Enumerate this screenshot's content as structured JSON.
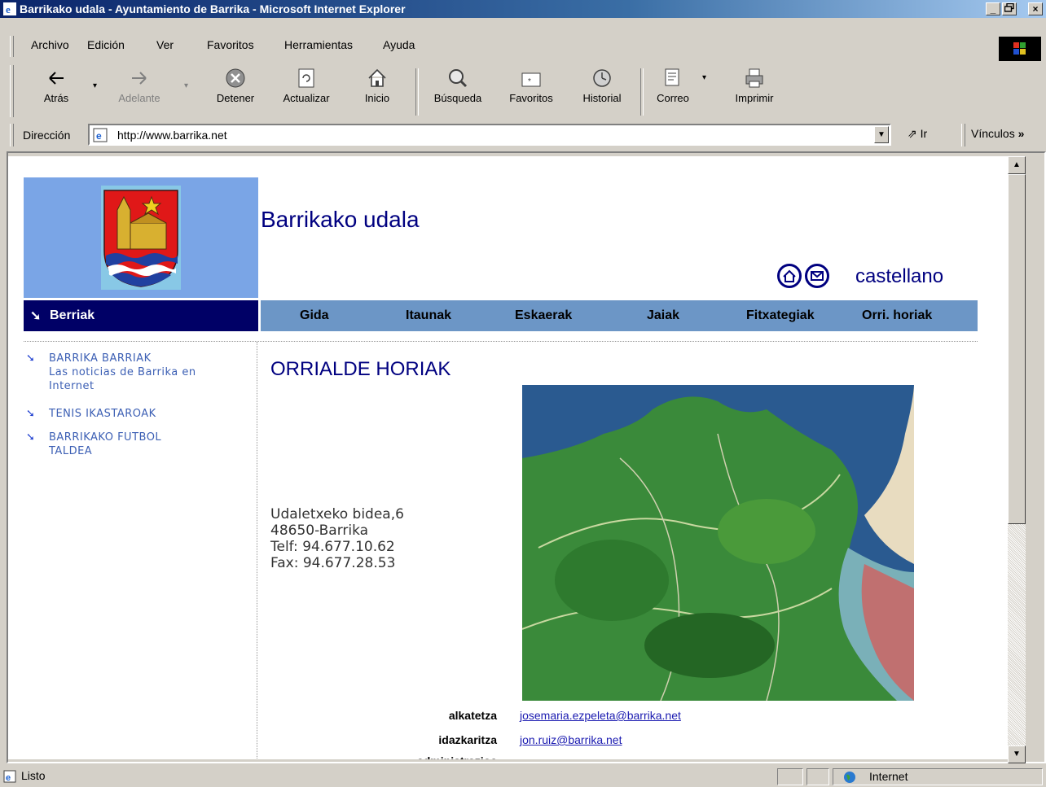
{
  "window": {
    "title": "Barrikako udala - Ayuntamiento de Barrika - Microsoft Internet Explorer",
    "buttons": [
      "_",
      "×"
    ]
  },
  "menu": [
    "Archivo",
    "Edición",
    "Ver",
    "Favoritos",
    "Herramientas",
    "Ayuda"
  ],
  "toolbar": {
    "back": "Atrás",
    "forward": "Adelante",
    "stop": "Detener",
    "refresh": "Actualizar",
    "home": "Inicio",
    "search": "Búsqueda",
    "favorites": "Favoritos",
    "history": "Historial",
    "mail": "Correo",
    "print": "Imprimir"
  },
  "address": {
    "label": "Dirección",
    "url": "http://www.barrika.net",
    "go": "Ir",
    "links": "Vínculos"
  },
  "page": {
    "site_title": "Barrikako udala",
    "language_link": "castellano",
    "sidebar_heading": "Berriak",
    "nav": [
      "Gida",
      "Itaunak",
      "Eskaerak",
      "Jaiak",
      "Fitxategiak",
      "Orri. horiak"
    ],
    "news": [
      {
        "title": "BARRIKA BARRIAK",
        "subtitle": "Las noticias de Barrika en Internet"
      },
      {
        "title": "TENIS IKASTAROAK"
      },
      {
        "title": "BARRIKAKO FUTBOL TALDEA"
      }
    ],
    "heading": "ORRIALDE HORIAK",
    "address_lines": [
      "Udaletxeko bidea,6",
      "48650-Barrika",
      "Telf: 94.677.10.62",
      "Fax: 94.677.28.53"
    ],
    "contacts": [
      {
        "label": "alkatetza",
        "email": "josemaria.ezpeleta@barrika.net"
      },
      {
        "label": "idazkaritza",
        "email": "jon.ruiz@barrika.net"
      },
      {
        "label": "administrazioa",
        "email": ""
      }
    ]
  },
  "status": {
    "text": "Listo",
    "zone": "Internet"
  },
  "colors": {
    "title_bar": "#0a246a",
    "nav_bar": "#6c96c6",
    "sidebar_head": "#000066",
    "logo_bg": "#7aa5e6",
    "heading": "#000080"
  }
}
